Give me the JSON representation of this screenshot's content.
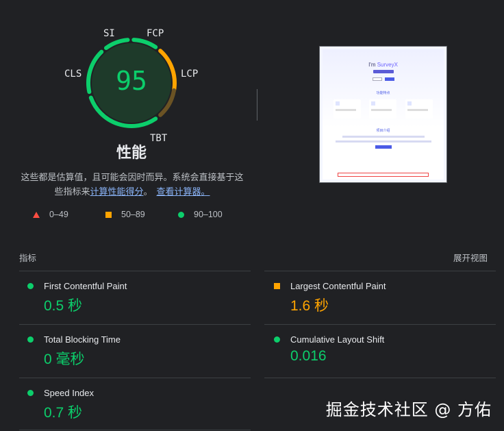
{
  "gauge": {
    "score": "95",
    "labels": {
      "si": "SI",
      "fcp": "FCP",
      "lcp": "LCP",
      "tbt": "TBT",
      "cls": "CLS"
    },
    "score_color": "#0cce6b",
    "title": "性能",
    "desc_text1": "这些都是估算值，且可能会因时而异。系统会直接基于这些指标来",
    "desc_link1": "计算性能得分",
    "desc_text2": "。",
    "desc_link2": "查看计算器。"
  },
  "legend": {
    "red": "0–49",
    "orange": "50–89",
    "green": "90–100"
  },
  "metrics": {
    "heading": "指标",
    "toggle": "展开视图",
    "items": [
      {
        "name": "First Contentful Paint",
        "value": "0.5 秒",
        "status": "green"
      },
      {
        "name": "Largest Contentful Paint",
        "value": "1.6 秒",
        "status": "orange"
      },
      {
        "name": "Total Blocking Time",
        "value": "0 毫秒",
        "status": "green"
      },
      {
        "name": "Cumulative Layout Shift",
        "value": "0.016",
        "status": "green"
      },
      {
        "name": "Speed Index",
        "value": "0.7 秒",
        "status": "green"
      }
    ]
  },
  "screenshot": {
    "title_prefix": "I'm ",
    "title_brand": "SurveyX",
    "section1": "功能特点",
    "section2": "项目介绍"
  },
  "colors": {
    "good": "#0cce6b",
    "average": "#ffa400",
    "poor": "#ff4e42"
  },
  "watermark": "掘金技术社区 @ 方佑"
}
